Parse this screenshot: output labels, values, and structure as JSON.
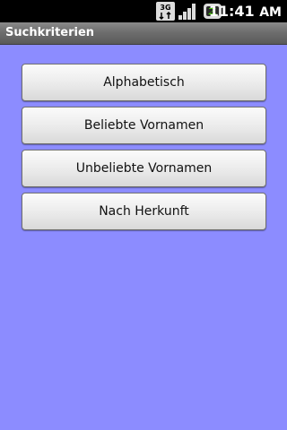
{
  "status_bar": {
    "time": "11:41",
    "time_suffix": "AM",
    "network_label": "3G",
    "icons": [
      "3g-data-icon",
      "signal-strength-icon",
      "battery-charging-icon"
    ]
  },
  "title_bar": {
    "title": "Suchkriterien"
  },
  "menu": {
    "buttons": [
      {
        "label": "Alphabetisch"
      },
      {
        "label": "Beliebte Vornamen"
      },
      {
        "label": "Unbeliebte Vornamen"
      },
      {
        "label": "Nach Herkunft"
      }
    ]
  },
  "colors": {
    "background": "#8c8cff",
    "status_bar": "#000000",
    "title_bar": "#6e6e6e",
    "battery_accent": "#43c800"
  }
}
